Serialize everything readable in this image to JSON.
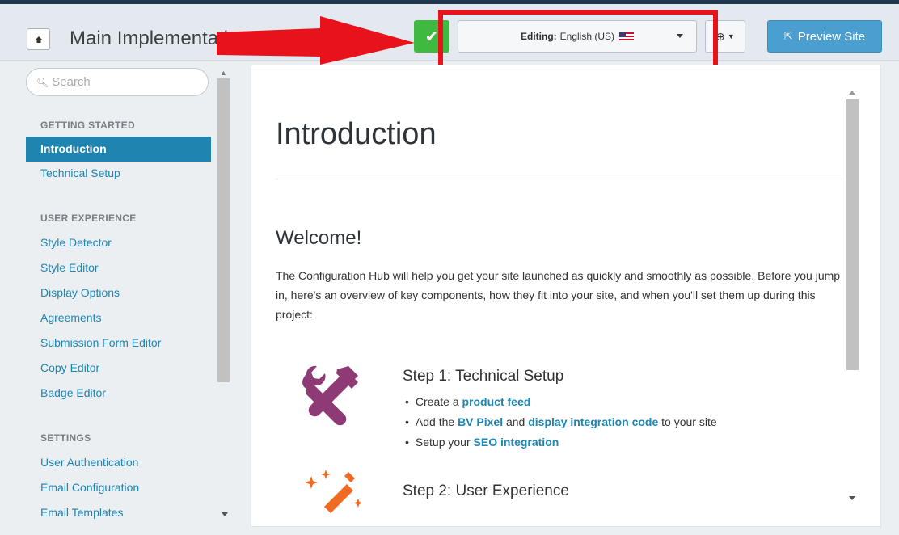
{
  "header": {
    "title": "Main Implementati",
    "editing_label": "Editing:",
    "editing_value": "English (US)",
    "preview_label": "Preview Site"
  },
  "sidebar": {
    "search_placeholder": "Search",
    "sections": [
      {
        "heading": "GETTING STARTED",
        "items": [
          "Introduction",
          "Technical Setup"
        ]
      },
      {
        "heading": "USER EXPERIENCE",
        "items": [
          "Style Detector",
          "Style Editor",
          "Display Options",
          "Agreements",
          "Submission Form Editor",
          "Copy Editor",
          "Badge Editor"
        ]
      },
      {
        "heading": "SETTINGS",
        "items": [
          "User Authentication",
          "Email Configuration",
          "Email Templates"
        ]
      }
    ],
    "active_item": "Introduction"
  },
  "content": {
    "title": "Introduction",
    "welcome": "Welcome!",
    "paragraph": "The Configuration Hub will help you get your site launched as quickly and smoothly as possible. Before you jump in, here's an overview of key components, how they fit into your site, and when you'll set them up during this project:",
    "step1": {
      "title": "Step 1: Technical Setup",
      "bullet1_pre": "Create a ",
      "bullet1_link": "product feed",
      "bullet2_pre": "Add the ",
      "bullet2_link1": "BV Pixel",
      "bullet2_mid": " and ",
      "bullet2_link2": "display integration code",
      "bullet2_post": " to your site",
      "bullet3_pre": "Setup your ",
      "bullet3_link": "SEO integration"
    },
    "step2": {
      "title": "Step 2: User Experience"
    }
  },
  "colors": {
    "accent": "#1f85b0",
    "link": "#1c86b5",
    "confirm": "#3fb93f",
    "preview": "#4a9fd0",
    "annotation": "#e8121b",
    "step1_icon": "#8e3a74",
    "step2_icon": "#f06a22"
  },
  "icons": [
    "home-icon",
    "check-icon",
    "us-flag-icon",
    "chevron-down-icon",
    "help-icon",
    "external-link-icon",
    "search-icon",
    "tools-icon",
    "magic-wand-icon"
  ]
}
